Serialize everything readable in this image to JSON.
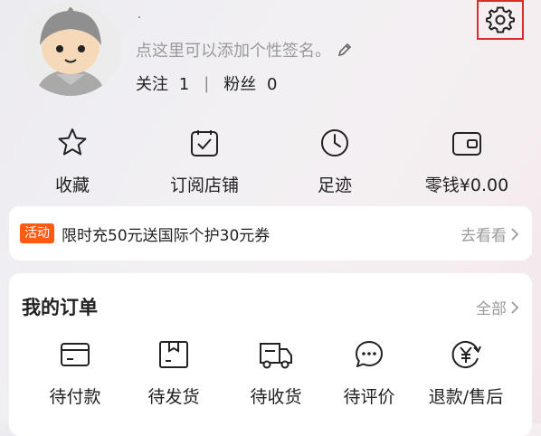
{
  "profile": {
    "signature_placeholder": "点这里可以添加个性签名。",
    "following_label": "关注",
    "following_count": "1",
    "separator": "|",
    "followers_label": "粉丝",
    "followers_count": "0"
  },
  "quick_actions": [
    {
      "label": "收藏",
      "icon": "star-icon"
    },
    {
      "label": "订阅店铺",
      "icon": "subscribe-check-icon"
    },
    {
      "label": "足迹",
      "icon": "clock-icon"
    },
    {
      "label": "零钱¥0.00",
      "icon": "wallet-icon"
    }
  ],
  "promo": {
    "badge": "活动",
    "text": "限时充50元送国际个护30元券",
    "more": "去看看"
  },
  "orders": {
    "title": "我的订单",
    "all": "全部",
    "items": [
      {
        "label": "待付款",
        "icon": "card-icon"
      },
      {
        "label": "待发货",
        "icon": "package-icon"
      },
      {
        "label": "待收货",
        "icon": "truck-icon"
      },
      {
        "label": "待评价",
        "icon": "chat-bubble-icon"
      },
      {
        "label": "退款/售后",
        "icon": "refund-yen-icon"
      }
    ]
  },
  "colors": {
    "accent_orange": "#ff5a12",
    "highlight_red": "#d62d2d",
    "muted_text": "#9a9a9a"
  }
}
